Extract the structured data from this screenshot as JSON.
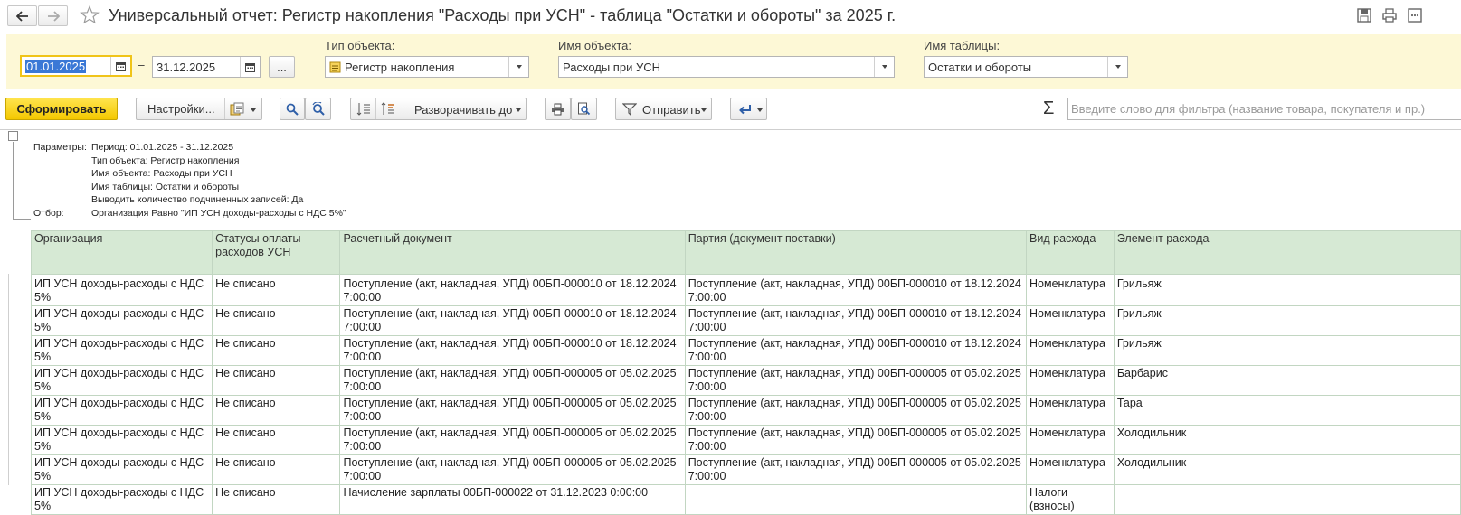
{
  "window": {
    "title": "Универсальный отчет: Регистр накопления \"Расходы при УСН\" - таблица \"Остатки и обороты\" за 2025 г."
  },
  "period": {
    "start": "01.01.2025",
    "dash": "–",
    "end": "31.12.2025",
    "more_label": "..."
  },
  "fields": {
    "object_type": {
      "label": "Тип объекта:",
      "value": "Регистр накопления"
    },
    "object_name": {
      "label": "Имя объекта:",
      "value": "Расходы при УСН"
    },
    "table_name": {
      "label": "Имя таблицы:",
      "value": "Остатки и обороты"
    }
  },
  "toolbar": {
    "generate": "Сформировать",
    "settings": "Настройки...",
    "expand_to": "Разворачивать до",
    "send": "Отправить",
    "sigma": "Σ",
    "filter_placeholder": "Введите слово для фильтра (название товара, покупателя и пр.)"
  },
  "report_params": {
    "params_label": "Параметры:",
    "filter_label": "Отбор:",
    "lines": [
      "Период: 01.01.2025 - 31.12.2025",
      "Тип объекта: Регистр накопления",
      "Имя объекта: Расходы при УСН",
      "Имя таблицы: Остатки и обороты",
      "Выводить количество подчиненных записей: Да"
    ],
    "filter": "Организация Равно \"ИП УСН доходы-расходы с НДС 5%\""
  },
  "table": {
    "columns": [
      "Организация",
      "Статусы оплаты расходов УСН",
      "Расчетный документ",
      "Партия (документ поставки)",
      "Вид расхода",
      "Элемент расхода"
    ],
    "rows": [
      [
        "ИП УСН доходы-расходы с НДС 5%",
        "Не списано",
        "Поступление (акт, накладная, УПД) 00БП-000010 от 18.12.2024 7:00:00",
        "Поступление (акт, накладная, УПД) 00БП-000010 от 18.12.2024 7:00:00",
        "Номенклатура",
        "Грильяж"
      ],
      [
        "ИП УСН доходы-расходы с НДС 5%",
        "Не списано",
        "Поступление (акт, накладная, УПД) 00БП-000010 от 18.12.2024 7:00:00",
        "Поступление (акт, накладная, УПД) 00БП-000010 от 18.12.2024 7:00:00",
        "Номенклатура",
        "Грильяж"
      ],
      [
        "ИП УСН доходы-расходы с НДС 5%",
        "Не списано",
        "Поступление (акт, накладная, УПД) 00БП-000010 от 18.12.2024 7:00:00",
        "Поступление (акт, накладная, УПД) 00БП-000010 от 18.12.2024 7:00:00",
        "Номенклатура",
        "Грильяж"
      ],
      [
        "ИП УСН доходы-расходы с НДС 5%",
        "Не списано",
        "Поступление (акт, накладная, УПД) 00БП-000005 от 05.02.2025 7:00:00",
        "Поступление (акт, накладная, УПД) 00БП-000005 от 05.02.2025 7:00:00",
        "Номенклатура",
        "Барбарис"
      ],
      [
        "ИП УСН доходы-расходы с НДС 5%",
        "Не списано",
        "Поступление (акт, накладная, УПД) 00БП-000005 от 05.02.2025 7:00:00",
        "Поступление (акт, накладная, УПД) 00БП-000005 от 05.02.2025 7:00:00",
        "Номенклатура",
        "Тара"
      ],
      [
        "ИП УСН доходы-расходы с НДС 5%",
        "Не списано",
        "Поступление (акт, накладная, УПД) 00БП-000005 от 05.02.2025 7:00:00",
        "Поступление (акт, накладная, УПД) 00БП-000005 от 05.02.2025 7:00:00",
        "Номенклатура",
        "Холодильник"
      ],
      [
        "ИП УСН доходы-расходы с НДС 5%",
        "Не списано",
        "Поступление (акт, накладная, УПД) 00БП-000005 от 05.02.2025 7:00:00",
        "Поступление (акт, накладная, УПД) 00БП-000005 от 05.02.2025 7:00:00",
        "Номенклатура",
        "Холодильник"
      ],
      [
        "ИП УСН доходы-расходы с НДС 5%",
        "Не списано",
        "Начисление зарплаты 00БП-000022 от 31.12.2023 0:00:00",
        "",
        "Налоги (взносы)",
        ""
      ]
    ]
  }
}
